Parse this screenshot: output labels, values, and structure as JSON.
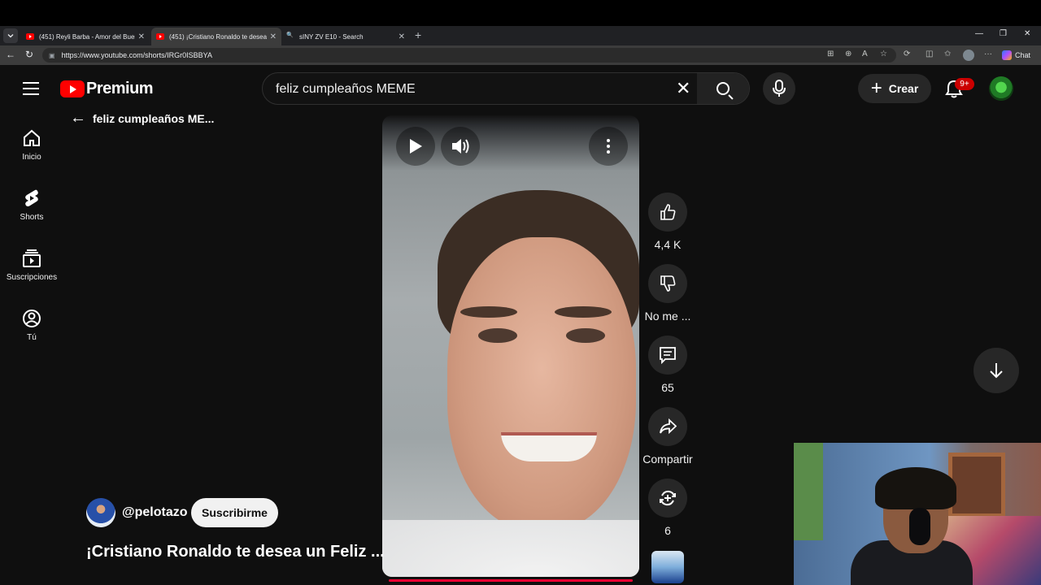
{
  "browser": {
    "tabs": [
      {
        "title": "(451) Reyli Barba - Amor del Buen",
        "favicon": "youtube-icon"
      },
      {
        "title": "(451) ¡Cristiano Ronaldo te desea",
        "favicon": "youtube-icon"
      },
      {
        "title": "sINY ZV E10 - Search",
        "favicon": "search-icon"
      }
    ],
    "url": "https://www.youtube.com/shorts/IRGr0ISBBYA",
    "chat_label": "Chat"
  },
  "youtube": {
    "logo_text": "Premium",
    "search_value": "feliz cumpleaños MEME",
    "create_label": "Crear",
    "notifications_badge": "9+",
    "sidebar": [
      {
        "label": "Inicio",
        "icon": "home-icon"
      },
      {
        "label": "Shorts",
        "icon": "shorts-icon"
      },
      {
        "label": "Suscripciones",
        "icon": "subscriptions-icon"
      },
      {
        "label": "Tú",
        "icon": "user-icon"
      }
    ],
    "back_title": "feliz cumpleaños ME...",
    "actions": {
      "like_count": "4,4 K",
      "dislike_label": "No me ...",
      "comment_count": "65",
      "share_label": "Compartir",
      "remix_count": "6"
    },
    "channel": {
      "handle": "@pelotazo",
      "subscribe_label": "Suscribirme"
    },
    "video_title": "¡Cristiano Ronaldo te desea un Feliz ...",
    "accent_color": "#ff0033"
  }
}
